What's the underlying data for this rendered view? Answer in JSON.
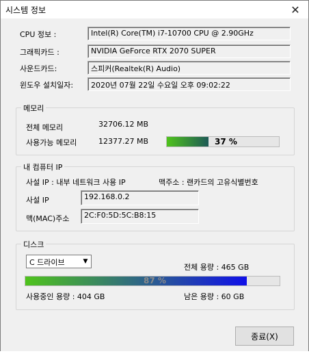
{
  "window": {
    "title": "시스템 정보",
    "close_glyph": "✕"
  },
  "system": {
    "cpu_label": "CPU 정보 :",
    "cpu_value": "Intel(R) Core(TM) i7-10700 CPU @ 2.90GHz",
    "gpu_label": "그래픽카드 :",
    "gpu_value": "NVIDIA GeForce RTX 2070 SUPER",
    "sound_label": "사운드카드:",
    "sound_value": "스피커(Realtek(R) Audio)",
    "install_label": "윈도우 설치일자:",
    "install_value": "2020년 07월 22일 수요일 오후 09:02:22"
  },
  "memory": {
    "group_title": "메모리",
    "total_label": "전체 메모리",
    "total_value": "32706.12 MB",
    "available_label": "사용가능 메모리",
    "available_value": "12377.27 MB",
    "percent_text": "37 %",
    "percent": 37
  },
  "network": {
    "group_title": "내 컴퓨터 IP",
    "internal_ip_label": "사설 IP : 내부 네트워크 사용 IP",
    "mac_desc_label": "맥주소 : 랜카드의 고유식별번호",
    "ip_label": "사설 IP",
    "ip_value": "192.168.0.2",
    "mac_label": "맥(MAC)주소",
    "mac_value": "2C:F0:5D:5C:B8:15"
  },
  "disk": {
    "group_title": "디스크",
    "drive_selected": "C 드라이브",
    "total_label": "전체 용량 : 465 GB",
    "percent_text": "87 %",
    "percent": 87,
    "used_label": "사용중인 용량 : 404 GB",
    "free_label": "남은 용량 : 60 GB"
  },
  "footer": {
    "close_label": "종료(X)"
  },
  "colors": {
    "memory_bar_start": "#4fc31c",
    "memory_bar_end": "#1e5a56",
    "disk_bar_start": "#4fc31c",
    "disk_bar_end": "#1010e8"
  }
}
